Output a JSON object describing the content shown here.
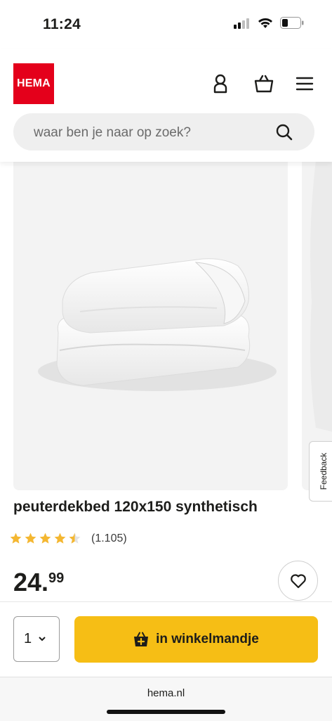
{
  "status_bar": {
    "time": "11:24"
  },
  "brand": {
    "logo_text": "HEMA",
    "color": "#e4001b"
  },
  "header": {
    "icons": [
      "account-icon",
      "basket-icon",
      "menu-icon"
    ]
  },
  "search": {
    "placeholder": "waar ben je naar op zoek?"
  },
  "product": {
    "title": "peuterdekbed 120x150 synthetisch",
    "rating": 4.5,
    "rating_max": 5,
    "review_count": "(1.105)",
    "price_main": "24.",
    "price_decimals": "99"
  },
  "feedback_label": "Feedback",
  "cart": {
    "quantity": "1",
    "button_label": "in winkelmandje",
    "button_color": "#f6be15"
  },
  "browser": {
    "url": "hema.nl"
  }
}
